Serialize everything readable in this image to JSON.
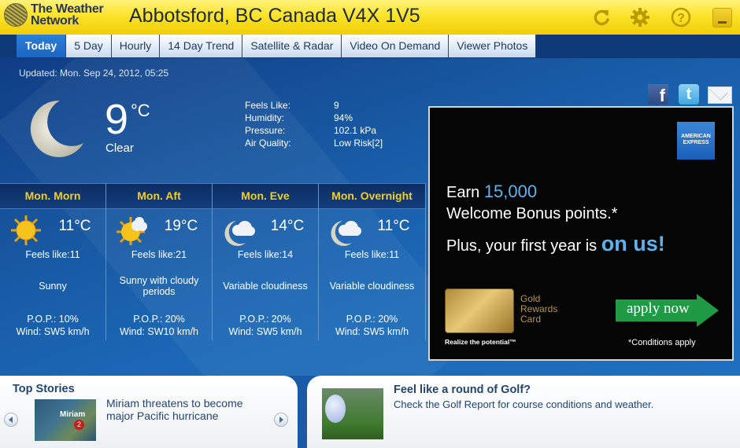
{
  "header": {
    "logo_line1": "The Weather",
    "logo_line2": "Network",
    "location": "Abbotsford, BC Canada V4X 1V5",
    "icons": [
      "refresh-icon",
      "gear-icon",
      "help-icon",
      "minimize-icon"
    ]
  },
  "nav": {
    "tabs": [
      {
        "label": "Today",
        "active": true
      },
      {
        "label": "5 Day",
        "active": false
      },
      {
        "label": "Hourly",
        "active": false
      },
      {
        "label": "14 Day Trend",
        "active": false
      },
      {
        "label": "Satellite & Radar",
        "active": false
      },
      {
        "label": "Video On Demand",
        "active": false
      },
      {
        "label": "Viewer Photos",
        "active": false
      }
    ]
  },
  "current": {
    "updated": "Updated: Mon. Sep 24, 2012, 05:25",
    "icon": "moon-icon",
    "temperature": "9",
    "unit": "°C",
    "condition": "Clear",
    "details": [
      {
        "label": "Feels Like:",
        "value": "9"
      },
      {
        "label": "Humidity:",
        "value": "94%"
      },
      {
        "label": "Pressure:",
        "value": "102.1 kPa"
      },
      {
        "label": "Air Quality:",
        "value": "Low Risk[2]"
      }
    ]
  },
  "social": {
    "facebook": "f",
    "twitter": "t"
  },
  "forecast": [
    {
      "period": "Mon. Morn",
      "icon": "sunny-icon",
      "temp": "11°C",
      "feels": "Feels like:11",
      "desc": "Sunny",
      "pop": "P.O.P.: 10%",
      "wind": "Wind: SW5 km/h"
    },
    {
      "period": "Mon. Aft",
      "icon": "sun-cloud-icon",
      "temp": "19°C",
      "feels": "Feels like:21",
      "desc": "Sunny with cloudy periods",
      "pop": "P.O.P.: 20%",
      "wind": "Wind: SW10 km/h"
    },
    {
      "period": "Mon. Eve",
      "icon": "moon-cloud-icon",
      "temp": "14°C",
      "feels": "Feels like:14",
      "desc": "Variable cloudiness",
      "pop": "P.O.P.: 20%",
      "wind": "Wind: SW5 km/h"
    },
    {
      "period": "Mon. Overnight",
      "icon": "moon-cloud-icon",
      "temp": "11°C",
      "feels": "Feels like:11",
      "desc": "Variable cloudiness",
      "pop": "P.O.P.: 20%",
      "wind": "Wind: SW5 km/h"
    }
  ],
  "ad": {
    "brand": "AMERICAN EXPRESS",
    "line1_prefix": "Earn ",
    "line1_highlight": "15,000",
    "line2": "Welcome Bonus points.*",
    "line3_prefix": "Plus, your first year is ",
    "line3_highlight": "on us!",
    "card_name_1": "Gold",
    "card_name_2": "Rewards",
    "card_name_3": "Card",
    "tagline": "Realize the potential™",
    "cta": "apply now",
    "conditions": "*Conditions apply",
    "colors": {
      "highlight": "#5db3ee",
      "cta": "#1f9a45"
    }
  },
  "top_stories": {
    "title": "Top Stories",
    "image_label": "Miriam",
    "image_badge": "2",
    "headline_line1": "Miriam threatens to become",
    "headline_line2": "major Pacific hurricane"
  },
  "golf": {
    "title": "Feel like a round of Golf?",
    "description": "Check the Golf Report for course conditions and weather."
  }
}
